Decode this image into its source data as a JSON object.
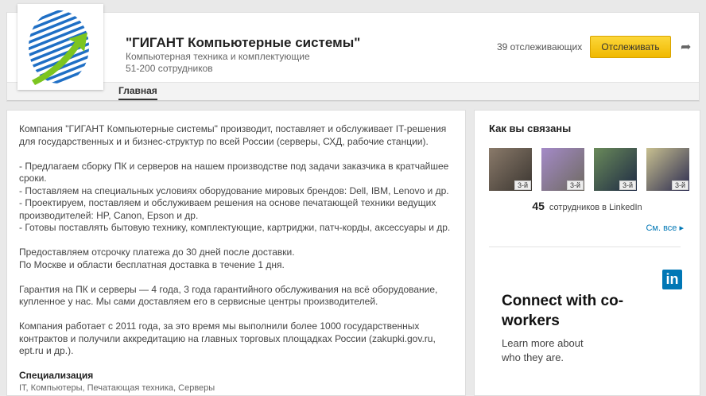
{
  "company": {
    "name": "\"ГИГАНТ Компьютерные системы\"",
    "industry": "Компьютерная техника и комплектующие",
    "size": "51-200 сотрудников",
    "followers": "39 отслеживающих",
    "follow_label": "Отслеживать"
  },
  "tabs": [
    {
      "label": "Главная"
    }
  ],
  "about": {
    "paragraphs": [
      "Компания \"ГИГАНТ Компьютерные системы\" производит, поставляет и обслуживает IT-решения для государственных и и бизнес-структур по всей России (серверы, СХД, рабочие станции).",
      "- Предлагаем сборку ПК и серверов на нашем производстве под задачи заказчика в кратчайшее сроки.\n- Поставляем на специальных условиях оборудование мировых брендов: Dell, IBM, Lenovo и др.\n- Проектируем, поставляем и обслуживаем решения на основе печатающей техники ведущих производителей: HP, Canon, Epson и др.\n- Готовы поставлять бытовую технику,  комплектующие, картриджи, патч-корды, аксессуары и др.",
      "Предоставляем отсрочку платежа до 30 дней после доставки.\nПо Москве и области бесплатная доставка в течение 1 дня.",
      "Гарантия на ПК и серверы — 4 года, 3 года гарантийного обслуживания на всё оборудование, купленное у нас. Мы сами доставляем его в сервисные центры производителей.",
      "Компания работает с 2011 года, за это время мы выполнили более 1000 государственных контрактов и получили аккредитацию на главных торговых площадках России (zakupki.gov.ru, ept.ru и др.)."
    ],
    "spec_title": "Специализация",
    "spec": "IT, Компьютеры, Печатающая техника, Серверы"
  },
  "sidebar": {
    "title": "Как вы связаны",
    "degree": "3-й",
    "employees_count": "45",
    "employees_label": "сотрудников в LinkedIn",
    "see_all": "См. все ▸"
  },
  "ad": {
    "logo": "in",
    "headline": "Connect with co-workers",
    "text": "Learn more about who they are."
  }
}
